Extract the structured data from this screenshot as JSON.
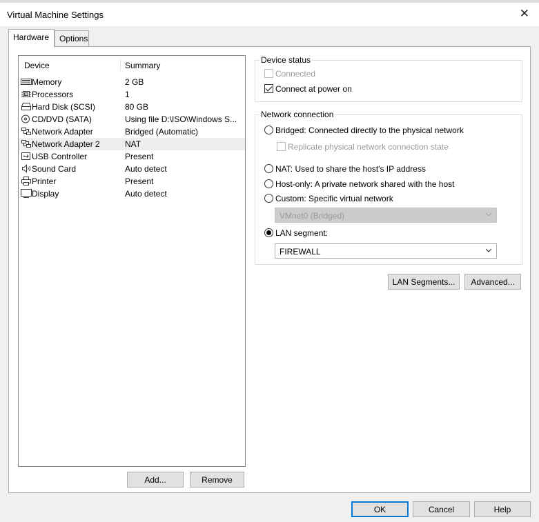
{
  "window": {
    "title": "Virtual Machine Settings",
    "close_glyph": "✕"
  },
  "tabs": [
    {
      "label": "Hardware"
    },
    {
      "label": "Options"
    }
  ],
  "device_list": {
    "columns": [
      "Device",
      "Summary"
    ],
    "rows": [
      {
        "device": "Memory",
        "summary": "2 GB",
        "icon": "memory-icon"
      },
      {
        "device": "Processors",
        "summary": "1",
        "icon": "processor-icon"
      },
      {
        "device": "Hard Disk (SCSI)",
        "summary": "80 GB",
        "icon": "hard-disk-icon"
      },
      {
        "device": "CD/DVD (SATA)",
        "summary": "Using file D:\\ISO\\Windows S...",
        "icon": "cd-dvd-icon"
      },
      {
        "device": "Network Adapter",
        "summary": "Bridged (Automatic)",
        "icon": "network-adapter-icon"
      },
      {
        "device": "Network Adapter 2",
        "summary": "NAT",
        "icon": "network-adapter-icon",
        "selected": true
      },
      {
        "device": "USB Controller",
        "summary": "Present",
        "icon": "usb-icon"
      },
      {
        "device": "Sound Card",
        "summary": "Auto detect",
        "icon": "speaker-icon"
      },
      {
        "device": "Printer",
        "summary": "Present",
        "icon": "printer-icon"
      },
      {
        "device": "Display",
        "summary": "Auto detect",
        "icon": "monitor-icon"
      }
    ]
  },
  "list_buttons": {
    "add": "Add...",
    "remove": "Remove"
  },
  "device_status": {
    "legend": "Device status",
    "connected": {
      "label": "Connected",
      "checked": false,
      "enabled": false
    },
    "connect_at_power_on": {
      "label": "Connect at power on",
      "checked": true
    }
  },
  "network_connection": {
    "legend": "Network connection",
    "bridged": "Bridged: Connected directly to the physical network",
    "replicate": "Replicate physical network connection state",
    "nat": "NAT: Used to share the host's IP address",
    "host_only": "Host-only: A private network shared with the host",
    "custom": "Custom: Specific virtual network",
    "custom_select_value": "VMnet0 (Bridged)",
    "lan_segment": "LAN segment:",
    "lan_segment_value": "FIREWALL",
    "selected_option": "lan_segment"
  },
  "network_buttons": {
    "lan_segments": "LAN Segments...",
    "advanced": "Advanced..."
  },
  "footer_buttons": {
    "ok": "OK",
    "cancel": "Cancel",
    "help": "Help"
  },
  "colors": {
    "window_bg": "#f0f0f0",
    "panel_bg": "#ffffff",
    "selected_row": "#eeeeee",
    "default_button_border": "#0078d7",
    "disabled_combo": "#cccccc"
  }
}
